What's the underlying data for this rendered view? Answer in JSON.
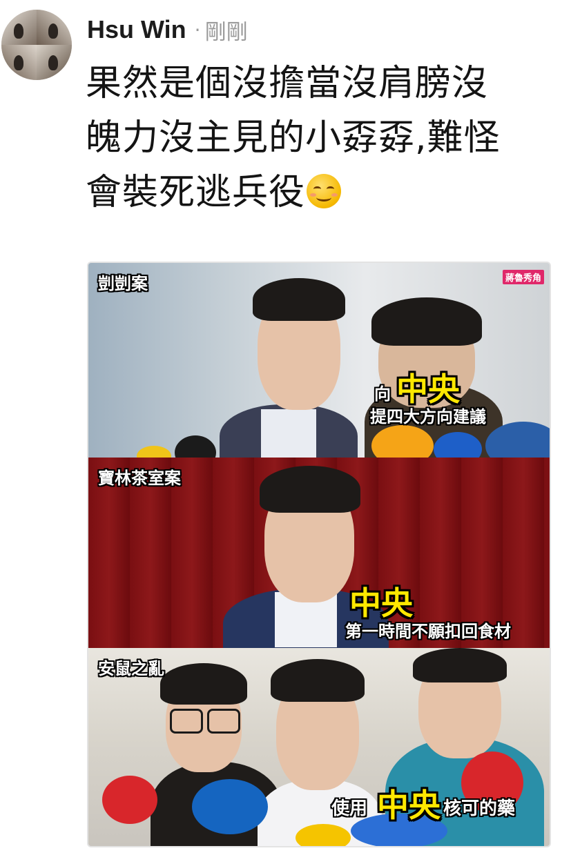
{
  "post": {
    "author": "Hsu Win",
    "separator": "·",
    "time": "剛剛",
    "text_line1": "果然是個沒擔當沒肩膀沒",
    "text_line2": "魄力沒主見的小孬孬,難怪",
    "text_line3": "會裝死逃兵役",
    "emoji": "relieved-face-icon"
  },
  "meme": {
    "panels": [
      {
        "tag": "剴剴案",
        "watermark": "蔣魯秀角",
        "caption_prefix": "向",
        "caption_big": "中央",
        "caption_small": "提四大方向建議"
      },
      {
        "tag": "寶林茶室案",
        "caption_big": "中央",
        "caption_small": "第一時間不願扣回食材"
      },
      {
        "tag": "安鼠之亂",
        "caption_prefix": "使用",
        "caption_big": "中央",
        "caption_suffix": "核可的藥"
      }
    ]
  },
  "colors": {
    "big_caption": "#ffe800",
    "panel2_background": "#7a0f12",
    "watermark": "#e0286a"
  }
}
